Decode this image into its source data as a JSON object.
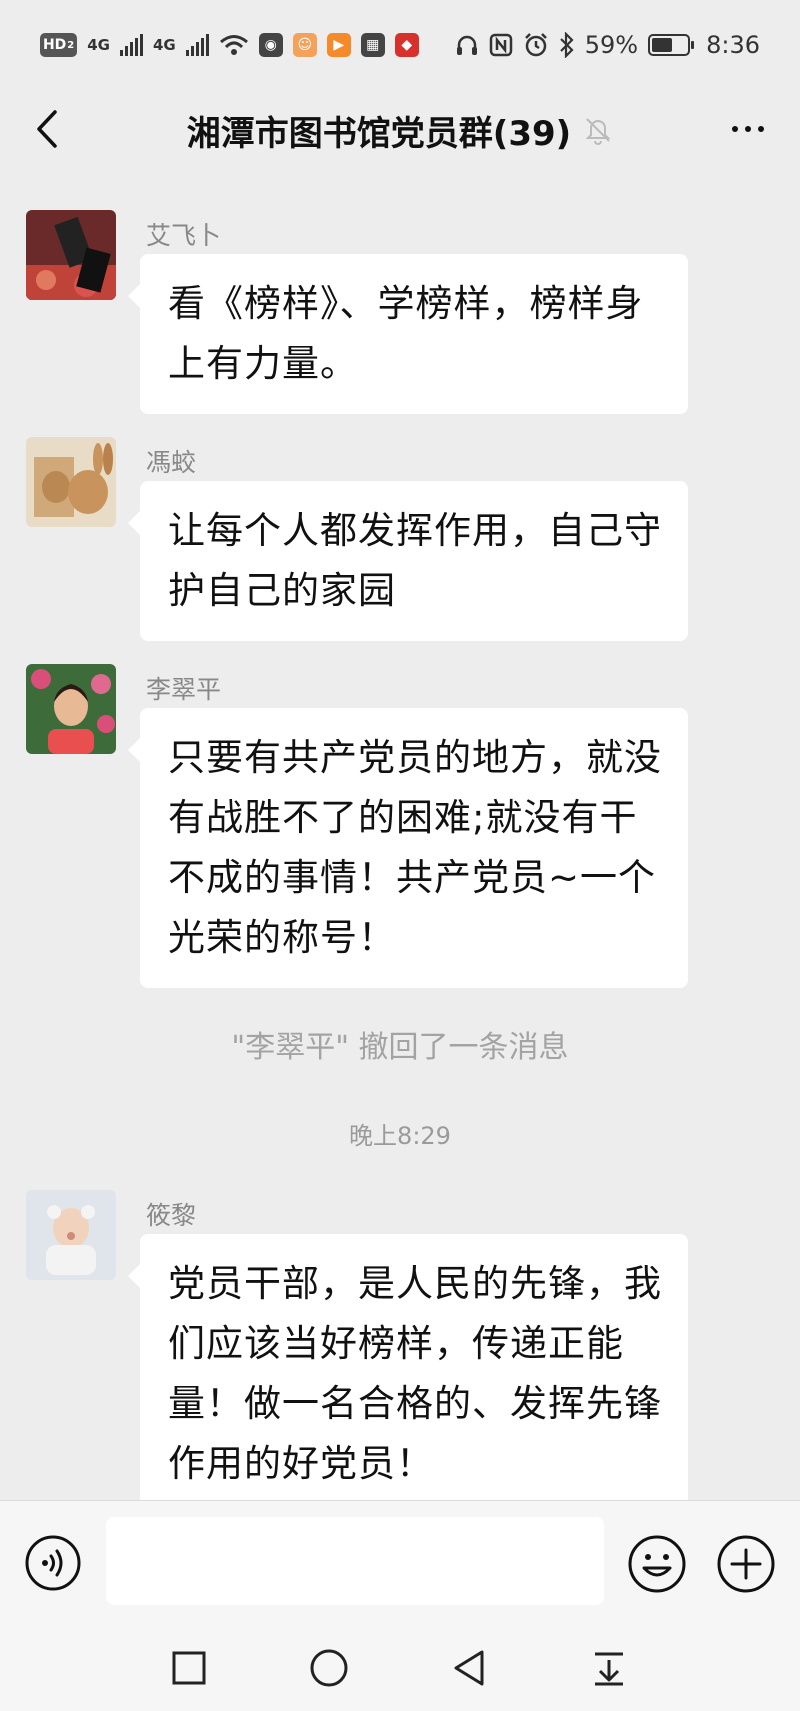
{
  "status_bar": {
    "hd_label": "HD",
    "hd_sub": "2",
    "net1": "4G",
    "net2": "4G",
    "battery_percent_text": "59%",
    "battery_level": 0.59,
    "time": "8:36",
    "app_icons": [
      "game-controller-icon",
      "cat-app-icon",
      "video-play-icon",
      "calendar-icon",
      "red-app-icon"
    ],
    "tray_icons": [
      "headphones-icon",
      "nfc-icon",
      "alarm-icon",
      "bluetooth-icon"
    ]
  },
  "header": {
    "title": "湘潭市图书馆党员群(39)",
    "muted": true
  },
  "messages": [
    {
      "sender": "艾飞卜",
      "text": "看《榜样》、学榜样，榜样身上有力量。"
    },
    {
      "sender": "馮蛟",
      "text": "让每个人都发挥作用，自己守护自己的家园"
    },
    {
      "sender": "李翠平",
      "text": "只要有共产党员的地方，就没有战胜不了的困难;就没有干不成的事情！共产党员~一个光荣的称号！"
    },
    {
      "sender": "筱黎",
      "text": "党员干部，是人民的先锋，我们应该当好榜样，传递正能量！做一名合格的、发挥先锋作用的好党员！"
    }
  ],
  "recall_notice": "\"李翠平\" 撤回了一条消息",
  "time_divider": "晚上8:29",
  "input": {
    "value": "",
    "placeholder": ""
  },
  "colors": {
    "background": "#ededed",
    "bubble": "#ffffff",
    "bar": "#f6f6f6"
  }
}
